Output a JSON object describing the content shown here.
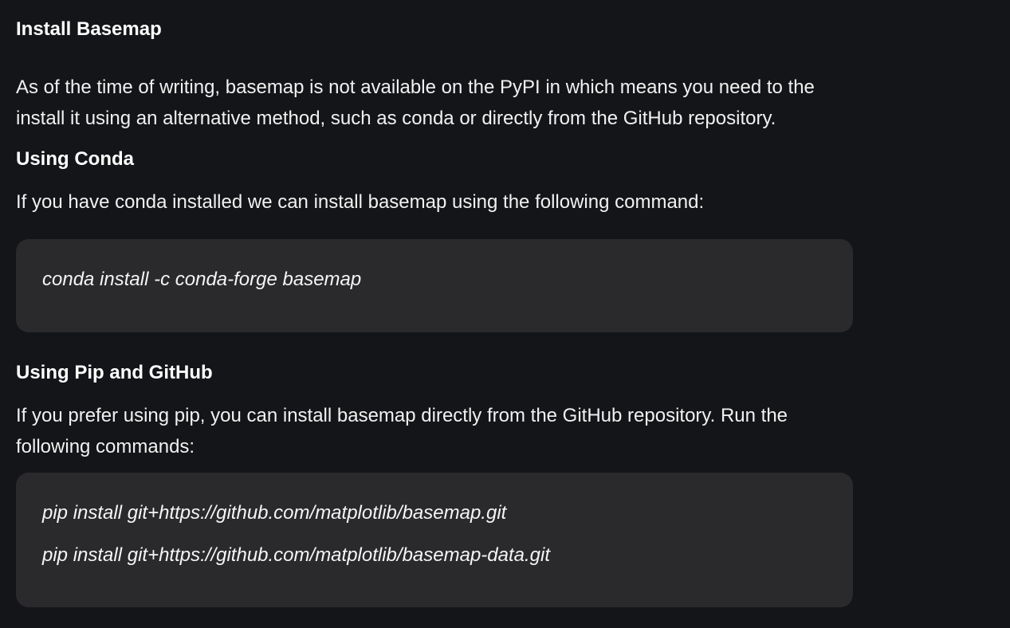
{
  "doc": {
    "title": "Install Basemap",
    "intro": "As of the time of writing, basemap is not available on the PyPI in which means you need to the install it using an alternative method, such as conda or directly from the GitHub repository.",
    "conda": {
      "heading": "Using Conda",
      "text": "If you have conda installed we can install basemap using the following command:",
      "commands": [
        "conda install -c conda-forge basemap"
      ]
    },
    "pip": {
      "heading": "Using Pip and GitHub",
      "text": "If you prefer using pip, you can install basemap directly from the GitHub repository. Run the following commands:",
      "commands": [
        "pip install git+https://github.com/matplotlib/basemap.git",
        "pip install git+https://github.com/matplotlib/basemap-data.git"
      ]
    }
  }
}
